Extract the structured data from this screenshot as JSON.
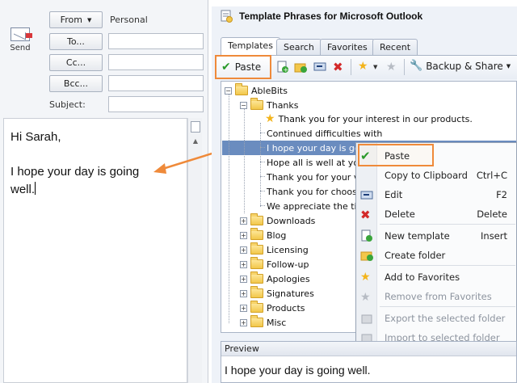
{
  "compose": {
    "send_label": "Send",
    "from_label": "From",
    "from_value": "Personal",
    "to_label": "To...",
    "cc_label": "Cc...",
    "bcc_label": "Bcc...",
    "subject_label": "Subject:",
    "body_greeting": "Hi Sarah,",
    "body_text": "I hope your day is going well."
  },
  "panel": {
    "title": "Template Phrases for Microsoft Outlook",
    "tabs": [
      "Templates",
      "Search",
      "Favorites",
      "Recent"
    ],
    "toolbar": {
      "paste_label": "Paste",
      "backup_label": "Backup & Share"
    },
    "tree": {
      "root": "AbleBits",
      "thanks_folder": "Thanks",
      "items": [
        "Thank you for your interest in our products.",
        "Continued difficulties with",
        "I hope your day is going well.",
        "Hope all is well at your",
        "Thank you for your val",
        "Thank you for choosing",
        "We appreciate the time"
      ],
      "folders": [
        "Downloads",
        "Blog",
        "Licensing",
        "Follow-up",
        "Apologies",
        "Signatures",
        "Products",
        "Misc"
      ]
    },
    "preview_label": "Preview",
    "preview_text": "I hope your day is going well."
  },
  "context_menu": {
    "items": [
      {
        "label": "Paste",
        "key": ""
      },
      {
        "label": "Copy to Clipboard",
        "key": "Ctrl+C"
      },
      {
        "label": "Edit",
        "key": "F2"
      },
      {
        "label": "Delete",
        "key": "Delete"
      },
      {
        "label": "New template",
        "key": "Insert"
      },
      {
        "label": "Create folder",
        "key": ""
      },
      {
        "label": "Add to Favorites",
        "key": ""
      },
      {
        "label": "Remove from Favorites",
        "key": ""
      },
      {
        "label": "Export the selected folder",
        "key": ""
      },
      {
        "label": "Import to selected folder",
        "key": ""
      }
    ]
  },
  "colors": {
    "accent": "#ef8a3a",
    "selection": "#6a8cbf",
    "folder": "#f2c74a"
  }
}
